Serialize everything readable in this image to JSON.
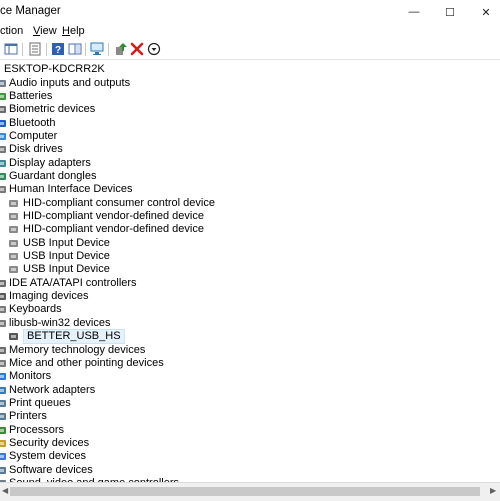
{
  "window": {
    "title": "ce Manager",
    "minimize_glyph": "—",
    "maximize_glyph": "☐",
    "close_glyph": "✕"
  },
  "menu": {
    "items": [
      {
        "name": "menu-action",
        "pre": "",
        "acc": "",
        "post": "ction"
      },
      {
        "name": "menu-view",
        "pre": "",
        "acc": "V",
        "post": "iew"
      },
      {
        "name": "menu-help",
        "pre": "",
        "acc": "H",
        "post": "elp"
      }
    ]
  },
  "toolbar": {
    "buttons": [
      {
        "name": "back-icon",
        "color": "#1a6fc9"
      },
      {
        "name": "forward-icon",
        "color": "#1a6fc9"
      },
      {
        "name": "show-hide-console-tree-icon",
        "color": "#4b6fa8"
      },
      {
        "name": "properties-icon",
        "color": "#6b6b6b"
      },
      {
        "name": "help-icon",
        "color": "#2f5fb3"
      },
      {
        "name": "toggle-view-icon",
        "color": "#4b6fa8"
      },
      {
        "name": "scan-hardware-icon",
        "color": "#2a7ab8"
      },
      {
        "name": "update-driver-icon",
        "color": "#2e8b2e"
      },
      {
        "name": "uninstall-device-icon",
        "color": "#d41c1c"
      },
      {
        "name": "enable-device-icon",
        "color": "#222222"
      }
    ]
  },
  "tree": {
    "root": {
      "label": "ESKTOP-KDCRR2K",
      "icon": "computer-icon"
    },
    "items": [
      {
        "level": 1,
        "label": "Audio inputs and outputs",
        "icon": "speaker-icon",
        "color": "#6f7f8f"
      },
      {
        "level": 1,
        "label": "Batteries",
        "icon": "battery-icon",
        "color": "#3a9a3a"
      },
      {
        "level": 1,
        "label": "Biometric devices",
        "icon": "fingerprint-icon",
        "color": "#6b6b6b"
      },
      {
        "level": 1,
        "label": "Bluetooth",
        "icon": "bluetooth-icon",
        "color": "#1a5fc9"
      },
      {
        "level": 1,
        "label": "Computer",
        "icon": "computer-icon",
        "color": "#3a8ad6"
      },
      {
        "level": 1,
        "label": "Disk drives",
        "icon": "disk-drive-icon",
        "color": "#777777"
      },
      {
        "level": 1,
        "label": "Display adapters",
        "icon": "display-adapter-icon",
        "color": "#3a8a9a"
      },
      {
        "level": 1,
        "label": "Guardant dongles",
        "icon": "dongle-icon",
        "color": "#2e8b57"
      },
      {
        "level": 1,
        "label": "Human Interface Devices",
        "icon": "hid-icon",
        "color": "#7a7a7a",
        "expanded": true
      },
      {
        "level": 2,
        "label": "HID-compliant consumer control device",
        "icon": "hid-device-icon",
        "color": "#8a8a8a"
      },
      {
        "level": 2,
        "label": "HID-compliant vendor-defined device",
        "icon": "hid-device-icon",
        "color": "#8a8a8a"
      },
      {
        "level": 2,
        "label": "HID-compliant vendor-defined device",
        "icon": "hid-device-icon",
        "color": "#8a8a8a"
      },
      {
        "level": 2,
        "label": "USB Input Device",
        "icon": "hid-device-icon",
        "color": "#8a8a8a"
      },
      {
        "level": 2,
        "label": "USB Input Device",
        "icon": "hid-device-icon",
        "color": "#8a8a8a"
      },
      {
        "level": 2,
        "label": "USB Input Device",
        "icon": "hid-device-icon",
        "color": "#8a8a8a"
      },
      {
        "level": 1,
        "label": "IDE ATA/ATAPI controllers",
        "icon": "ide-controller-icon",
        "color": "#6b6b6b"
      },
      {
        "level": 1,
        "label": "Imaging devices",
        "icon": "camera-icon",
        "color": "#5a5a5a"
      },
      {
        "level": 1,
        "label": "Keyboards",
        "icon": "keyboard-icon",
        "color": "#7a7a7a"
      },
      {
        "level": 1,
        "label": "libusb-win32 devices",
        "icon": "usb-device-icon",
        "color": "#7a7a7a",
        "expanded": true
      },
      {
        "level": 2,
        "label": "BETTER_USB_HS",
        "icon": "usb-plug-icon",
        "color": "#555555",
        "selected": true
      },
      {
        "level": 1,
        "label": "Memory technology devices",
        "icon": "memory-icon",
        "color": "#6b6b6b"
      },
      {
        "level": 1,
        "label": "Mice and other pointing devices",
        "icon": "mouse-icon",
        "color": "#7a7a7a"
      },
      {
        "level": 1,
        "label": "Monitors",
        "icon": "monitor-icon",
        "color": "#2a7ad6"
      },
      {
        "level": 1,
        "label": "Network adapters",
        "icon": "network-adapter-icon",
        "color": "#3a7ab8"
      },
      {
        "level": 1,
        "label": "Print queues",
        "icon": "printer-icon",
        "color": "#5a7a9a"
      },
      {
        "level": 1,
        "label": "Printers",
        "icon": "printer-icon",
        "color": "#5a7a9a"
      },
      {
        "level": 1,
        "label": "Processors",
        "icon": "processor-icon",
        "color": "#3a8a3a"
      },
      {
        "level": 1,
        "label": "Security devices",
        "icon": "key-icon",
        "color": "#c8a020"
      },
      {
        "level": 1,
        "label": "System devices",
        "icon": "system-devices-icon",
        "color": "#3a7ad6"
      },
      {
        "level": 1,
        "label": "Software devices",
        "icon": "software-device-icon",
        "color": "#5a7a9a"
      },
      {
        "level": 1,
        "label": "Sound, video and game controllers",
        "icon": "sound-icon",
        "color": "#6f7f8f"
      }
    ]
  }
}
